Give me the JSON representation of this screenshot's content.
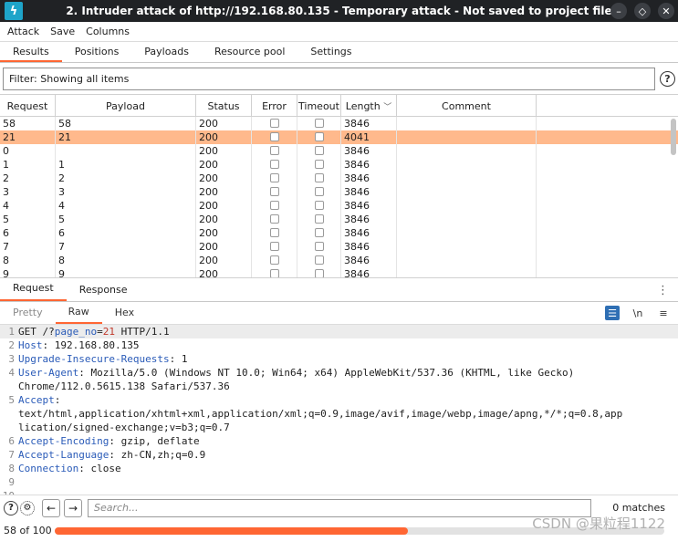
{
  "window": {
    "title": "2. Intruder attack of http://192.168.80.135 - Temporary attack - Not saved to project file"
  },
  "menu": [
    "Attack",
    "Save",
    "Columns"
  ],
  "tabs": [
    "Results",
    "Positions",
    "Payloads",
    "Resource pool",
    "Settings"
  ],
  "filter": {
    "text": "Filter: Showing all items"
  },
  "table": {
    "columns": [
      "Request",
      "Payload",
      "Status",
      "Error",
      "Timeout",
      "Length",
      "Comment"
    ],
    "rows": [
      {
        "request": "58",
        "payload": "58",
        "status": "200",
        "length": "3846"
      },
      {
        "request": "21",
        "payload": "21",
        "status": "200",
        "length": "4041"
      },
      {
        "request": "0",
        "payload": "",
        "status": "200",
        "length": "3846"
      },
      {
        "request": "1",
        "payload": "1",
        "status": "200",
        "length": "3846"
      },
      {
        "request": "2",
        "payload": "2",
        "status": "200",
        "length": "3846"
      },
      {
        "request": "3",
        "payload": "3",
        "status": "200",
        "length": "3846"
      },
      {
        "request": "4",
        "payload": "4",
        "status": "200",
        "length": "3846"
      },
      {
        "request": "5",
        "payload": "5",
        "status": "200",
        "length": "3846"
      },
      {
        "request": "6",
        "payload": "6",
        "status": "200",
        "length": "3846"
      },
      {
        "request": "7",
        "payload": "7",
        "status": "200",
        "length": "3846"
      },
      {
        "request": "8",
        "payload": "8",
        "status": "200",
        "length": "3846"
      },
      {
        "request": "9",
        "payload": "9",
        "status": "200",
        "length": "3846"
      }
    ],
    "highlight_color": "#ffb98c"
  },
  "request_tabs": [
    "Request",
    "Response"
  ],
  "view_tabs": [
    "Pretty",
    "Raw",
    "Hex"
  ],
  "view_icons": {
    "newline": "\\n"
  },
  "editor_lines": [
    {
      "n": "1",
      "key": "GET /?",
      "param": "page_no",
      "eq": "=",
      "value": "21",
      "rest": " HTTP/1.1"
    },
    {
      "n": "2",
      "key": "Host",
      "rest": ": 192.168.80.135"
    },
    {
      "n": "3",
      "key": "Upgrade-Insecure-Requests",
      "rest": ": 1"
    },
    {
      "n": "4",
      "key": "User-Agent",
      "rest": ": Mozilla/5.0 (Windows NT 10.0; Win64; x64) AppleWebKit/537.36 (KHTML, like Gecko)"
    },
    {
      "n": "",
      "rest": "Chrome/112.0.5615.138 Safari/537.36"
    },
    {
      "n": "5",
      "key": "Accept",
      "rest": ":"
    },
    {
      "n": "",
      "rest": "text/html,application/xhtml+xml,application/xml;q=0.9,image/avif,image/webp,image/apng,*/*;q=0.8,app"
    },
    {
      "n": "",
      "rest": "lication/signed-exchange;v=b3;q=0.7"
    },
    {
      "n": "6",
      "key": "Accept-Encoding",
      "rest": ": gzip, deflate"
    },
    {
      "n": "7",
      "key": "Accept-Language",
      "rest": ": zh-CN,zh;q=0.9"
    },
    {
      "n": "8",
      "key": "Connection",
      "rest": ": close"
    },
    {
      "n": "9",
      "rest": ""
    },
    {
      "n": "10",
      "rest": ""
    }
  ],
  "search": {
    "placeholder": "Search..."
  },
  "matches": "0 matches",
  "progress": {
    "label": "58 of 100",
    "fraction": 0.58,
    "color": "#ff6633"
  },
  "watermark": "CSDN @果粒程1122"
}
